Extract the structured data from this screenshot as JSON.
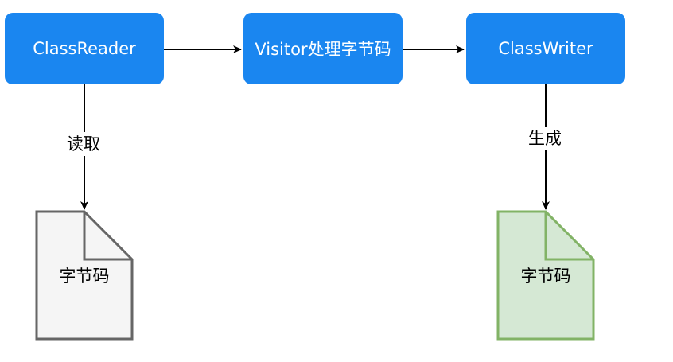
{
  "nodes": {
    "class_reader": "ClassReader",
    "visitor": "Visitor处理字节码",
    "class_writer": "ClassWriter"
  },
  "edges": {
    "read": "读取",
    "generate": "生成"
  },
  "documents": {
    "input": "字节码",
    "output": "字节码"
  },
  "colors": {
    "node_fill": "#1a86f0",
    "node_text": "#ffffff",
    "input_doc_fill": "#f5f5f5",
    "input_doc_stroke": "#666666",
    "output_doc_fill": "#d5e8d4",
    "output_doc_stroke": "#82b366",
    "edge": "#000000"
  }
}
